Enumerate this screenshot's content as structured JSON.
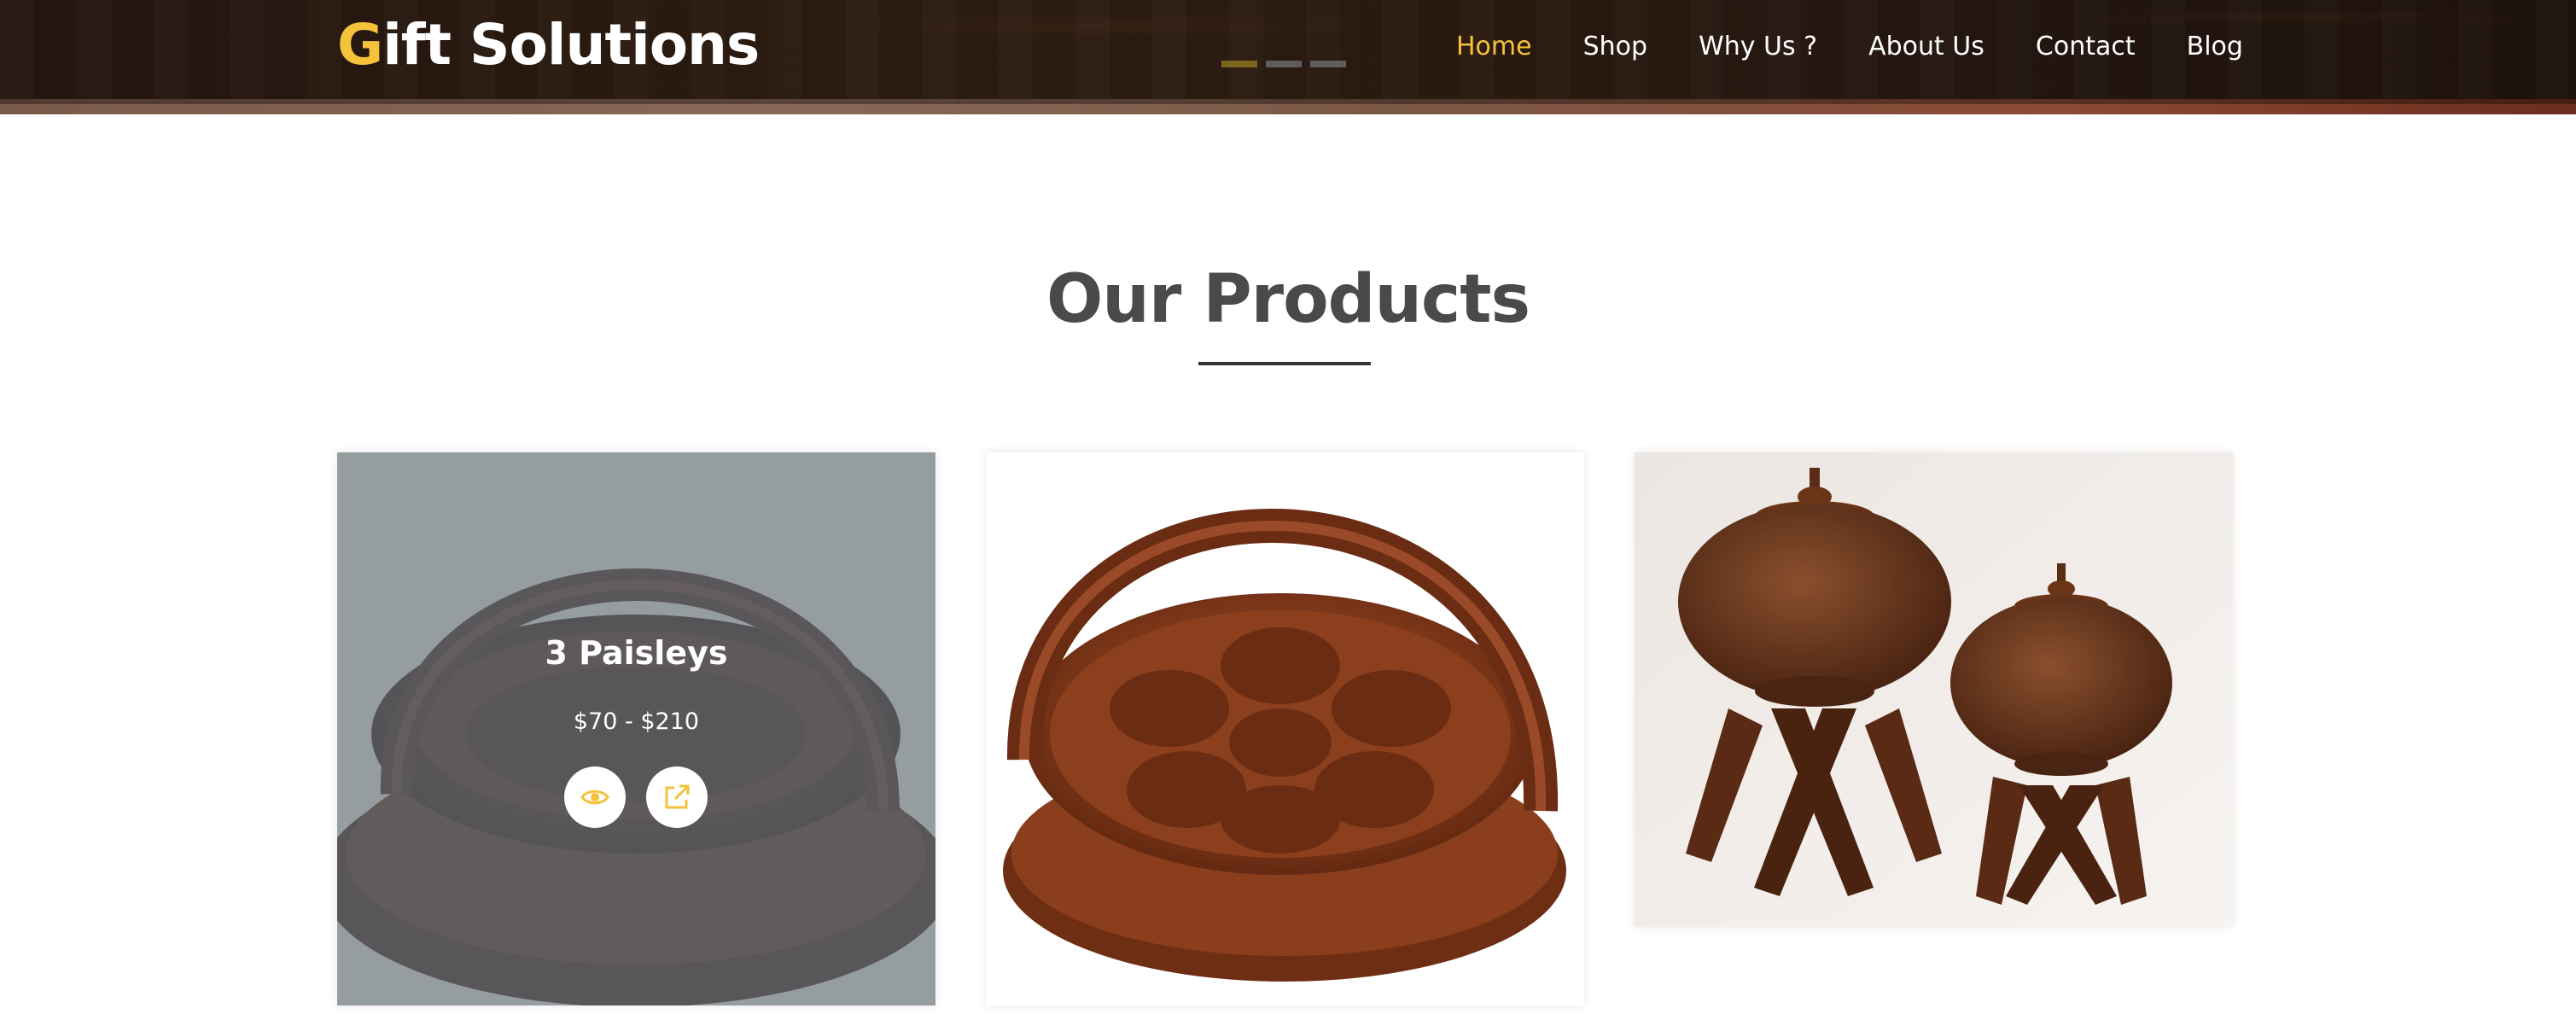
{
  "header": {
    "logo_first_letter": "G",
    "logo_rest": "ift Solutions",
    "nav": [
      {
        "label": "Home",
        "active": true
      },
      {
        "label": "Shop",
        "active": false
      },
      {
        "label": "Why Us ?",
        "active": false
      },
      {
        "label": "About Us",
        "active": false
      },
      {
        "label": "Contact",
        "active": false
      },
      {
        "label": "Blog",
        "active": false
      }
    ],
    "slider": {
      "count": 3,
      "active_index": 0
    }
  },
  "section": {
    "title": "Our Products"
  },
  "products": [
    {
      "name": "3 Paisleys",
      "price": "$70 - $210",
      "hovered": true,
      "image_icon": "wooden-paisley-basket-image",
      "view_icon": "eye-icon",
      "link_icon": "external-link-icon"
    },
    {
      "image_icon": "wooden-heart-tray-basket-image",
      "hovered": false
    },
    {
      "image_icon": "wooden-jars-on-stands-image",
      "hovered": false
    }
  ],
  "colors": {
    "accent": "#f5c23c",
    "header_bg": "#231610",
    "title_text": "#4a4a4a",
    "overlay": "#6c7a86",
    "white": "#ffffff"
  }
}
